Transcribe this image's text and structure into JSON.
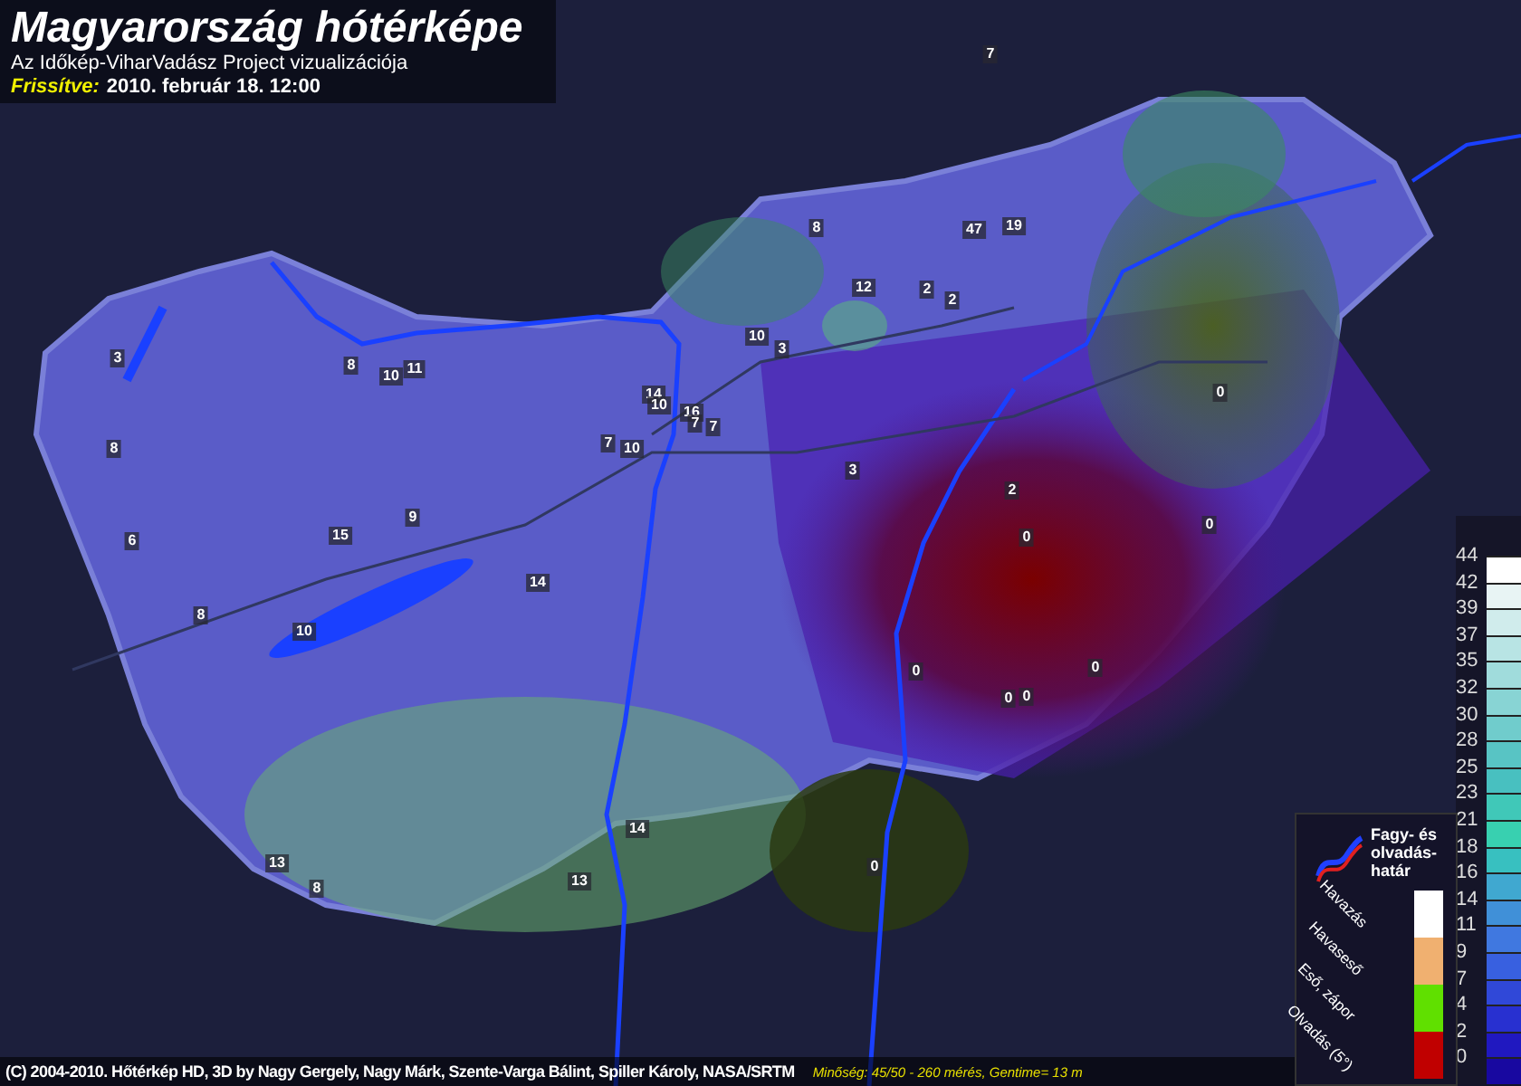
{
  "header": {
    "title": "Magyarország hótérképe",
    "subtitle": "Az Időkép-ViharVadász Project vizualizációja",
    "updated_label": "Frissítve:",
    "updated_value": "2010. február 18. 12:00"
  },
  "stations": [
    {
      "value": "7"
    },
    {
      "value": "8"
    },
    {
      "value": "47"
    },
    {
      "value": "19"
    },
    {
      "value": "12"
    },
    {
      "value": "2"
    },
    {
      "value": "2"
    },
    {
      "value": "3"
    },
    {
      "value": "8"
    },
    {
      "value": "10"
    },
    {
      "value": "11"
    },
    {
      "value": "10"
    },
    {
      "value": "3"
    },
    {
      "value": "14"
    },
    {
      "value": "10"
    },
    {
      "value": "16"
    },
    {
      "value": "7"
    },
    {
      "value": "7"
    },
    {
      "value": "0"
    },
    {
      "value": "8"
    },
    {
      "value": "7"
    },
    {
      "value": "10"
    },
    {
      "value": "3"
    },
    {
      "value": "2"
    },
    {
      "value": "6"
    },
    {
      "value": "15"
    },
    {
      "value": "9"
    },
    {
      "value": "0"
    },
    {
      "value": "0"
    },
    {
      "value": "14"
    },
    {
      "value": "8"
    },
    {
      "value": "10"
    },
    {
      "value": "0"
    },
    {
      "value": "0"
    },
    {
      "value": "0"
    },
    {
      "value": "0"
    },
    {
      "value": "14"
    },
    {
      "value": "13"
    },
    {
      "value": "8"
    },
    {
      "value": "13"
    },
    {
      "value": "0"
    }
  ],
  "precip_legend": {
    "boundary_label": "Fagy- és olvadás-határ",
    "items": [
      {
        "label": "Havazás",
        "color": "#ffffff"
      },
      {
        "label": "Havaseső",
        "color": "#f0b070"
      },
      {
        "label": "Eső, zápor",
        "color": "#60e000"
      },
      {
        "label": "Olvadás (5°)",
        "color": "#c00000"
      }
    ]
  },
  "depth_scale": [
    {
      "label": "44",
      "color": "#ffffff"
    },
    {
      "label": "42",
      "color": "#e8f4f4"
    },
    {
      "label": "39",
      "color": "#d0ecec"
    },
    {
      "label": "37",
      "color": "#b8e4e4"
    },
    {
      "label": "35",
      "color": "#a0dcdc"
    },
    {
      "label": "32",
      "color": "#88d4d4"
    },
    {
      "label": "30",
      "color": "#70cccc"
    },
    {
      "label": "28",
      "color": "#58c4c4"
    },
    {
      "label": "25",
      "color": "#48c0c0"
    },
    {
      "label": "23",
      "color": "#40c8b8"
    },
    {
      "label": "21",
      "color": "#38d0b0"
    },
    {
      "label": "18",
      "color": "#38c0c0"
    },
    {
      "label": "16",
      "color": "#40a8d0"
    },
    {
      "label": "14",
      "color": "#4090d8"
    },
    {
      "label": "11",
      "color": "#4078e0"
    },
    {
      "label": "9",
      "color": "#3860e0"
    },
    {
      "label": "7",
      "color": "#3048d8"
    },
    {
      "label": "4",
      "color": "#2830d0"
    },
    {
      "label": "2",
      "color": "#2018c0"
    },
    {
      "label": "0",
      "color": "#1808a0"
    }
  ],
  "footer": {
    "credits": "(C) 2004-2010. Hőtérkép HD, 3D by Nagy Gergely, Nagy Márk, Szente-Varga Bálint, Spiller Károly, NASA/SRTM",
    "quality": "Minőség: 45/50 - 260 mérés, Gentime= 13 m"
  }
}
